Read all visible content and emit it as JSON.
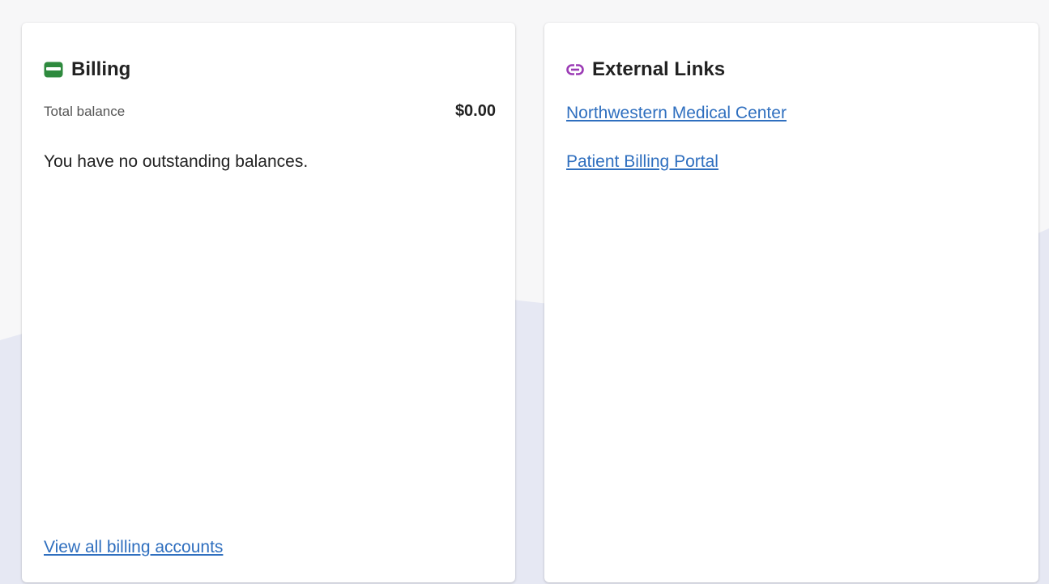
{
  "colors": {
    "billing_icon": "#2e8a3e",
    "link_icon": "#9b3bb5",
    "link": "#2f6fbf",
    "background_wave": "#e6e8f3"
  },
  "billing": {
    "icon": "credit-card-icon",
    "title": "Billing",
    "total_balance_label": "Total balance",
    "total_balance_amount": "$0.00",
    "no_balance_message": "You have no outstanding balances.",
    "view_all_link": "View all billing accounts"
  },
  "external_links": {
    "icon": "link-icon",
    "title": "External Links",
    "links": [
      {
        "label": "Northwestern Medical Center"
      },
      {
        "label": "Patient Billing Portal"
      }
    ]
  }
}
